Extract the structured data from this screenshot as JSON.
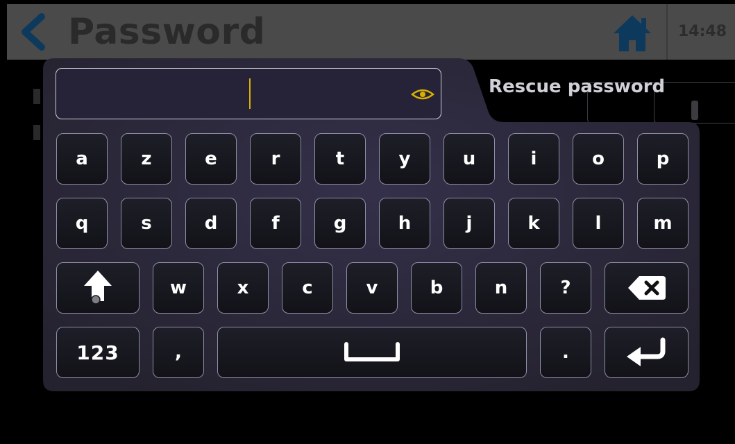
{
  "header": {
    "back_icon": "chevron-left-icon",
    "title": "Password",
    "home_icon": "home-icon",
    "time": "14:48"
  },
  "background": {
    "rescue_label": "Rescue password"
  },
  "colors": {
    "accent": "#0d3a5c",
    "caret": "#d8b000",
    "panel": "#2b2838",
    "key_border": "#8e8fa6"
  },
  "keyboard": {
    "input": {
      "value": "",
      "placeholder": ""
    },
    "eye_icon": "eye-icon",
    "row1": [
      "a",
      "z",
      "e",
      "r",
      "t",
      "y",
      "u",
      "i",
      "o",
      "p"
    ],
    "row2": [
      "q",
      "s",
      "d",
      "f",
      "g",
      "h",
      "j",
      "k",
      "l",
      "m"
    ],
    "row3": [
      "w",
      "x",
      "c",
      "v",
      "b",
      "n",
      "?"
    ],
    "shift_icon": "shift-arrow-icon",
    "backspace_icon": "backspace-icon",
    "numbers_label": "123",
    "comma_label": ",",
    "space_icon": "space-bar-icon",
    "period_label": ".",
    "enter_icon": "enter-icon"
  }
}
